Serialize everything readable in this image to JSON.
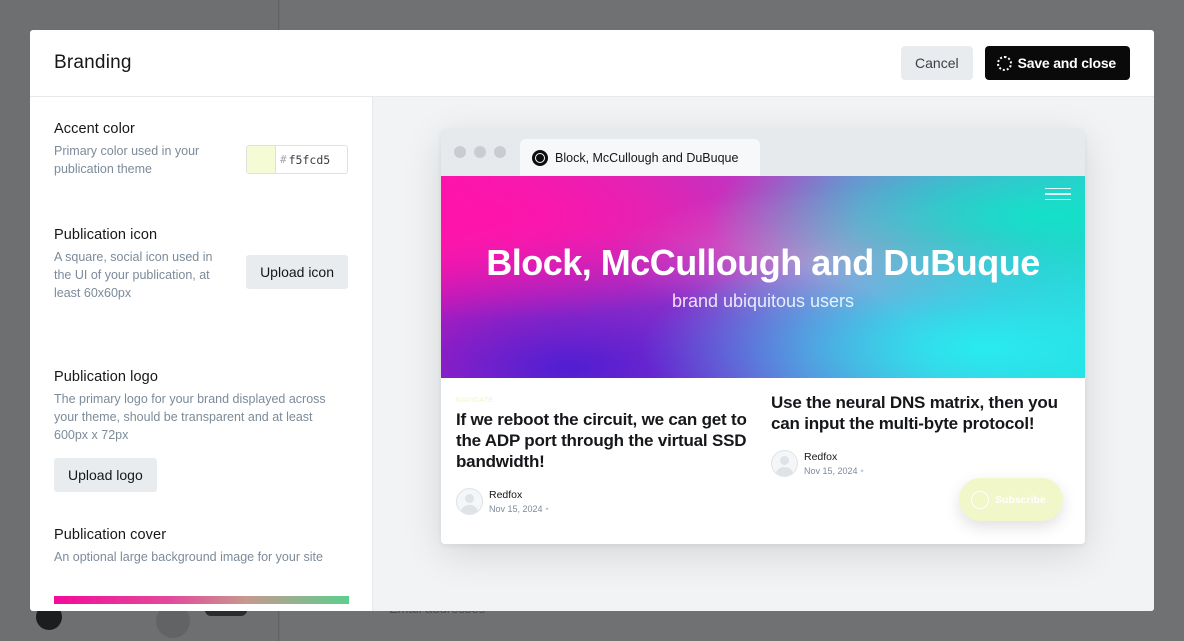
{
  "background": {
    "bottom_text": "Email addresses"
  },
  "modal": {
    "title": "Branding",
    "cancel_label": "Cancel",
    "save_label": "Save and close"
  },
  "settings": {
    "accent": {
      "title": "Accent color",
      "description": "Primary color used in your publication theme",
      "hash": "#",
      "value": "f5fcd5",
      "color": "#f5fcd5"
    },
    "icon": {
      "title": "Publication icon",
      "description": "A square, social icon used in the UI of your publication, at least 60x60px",
      "button": "Upload icon"
    },
    "logo": {
      "title": "Publication logo",
      "description": "The primary logo for your brand displayed across your theme, should be transparent and at least 600px x 72px",
      "button": "Upload logo"
    },
    "cover": {
      "title": "Publication cover",
      "description": "An optional large background image for your site"
    }
  },
  "preview": {
    "tab_title": "Block, McCullough and DuBuque",
    "site_title": "Block, McCullough and DuBuque",
    "site_description": "brand ubiquitous users",
    "posts": [
      {
        "tag": "NAVIGATE",
        "title": "If we reboot the circuit, we can get to the ADP port through the virtual SSD bandwidth!",
        "author": "Redfox",
        "date": "Nov 15, 2024",
        "sep": "•"
      },
      {
        "title": "Use the neural DNS matrix, then you can input the multi-byte protocol!",
        "author": "Redfox",
        "date": "Nov 15, 2024",
        "sep": "•"
      }
    ],
    "subscribe_label": "Subscribe"
  }
}
